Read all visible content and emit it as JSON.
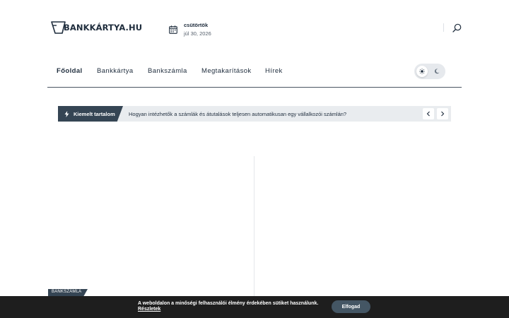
{
  "header": {
    "logo_text": "BANKKÁRTYA.HU",
    "date_day": "csütörtök",
    "date_value": "júl 30, 2026",
    "icons": {
      "calendar": "calendar-icon",
      "search": "search-icon"
    }
  },
  "nav": {
    "items": [
      {
        "label": "Főoldal",
        "active": true
      },
      {
        "label": "Bankkártya",
        "active": false
      },
      {
        "label": "Bankszámla",
        "active": false
      },
      {
        "label": "Megtakarítások",
        "active": false
      },
      {
        "label": "Hírek",
        "active": false
      }
    ],
    "theme_toggle": {
      "mode": "light",
      "icons": [
        "sun-icon",
        "moon-icon"
      ]
    }
  },
  "ticker": {
    "label": "Kiemelt tartalom",
    "headline": "Hogyan intézhetők a számlák és átutalások teljesen automatikusan egy vállalkozói számlán?",
    "icons": [
      "bolt-icon",
      "chevron-left-icon",
      "chevron-right-icon"
    ]
  },
  "content": {
    "category_tag": "BANKSZÁMLA"
  },
  "cookie": {
    "message": "A weboldalon a minőségi felhasználói élmény érdekében sütiket használunk.",
    "details_link": "Részletek",
    "accept_label": "Elfogad"
  },
  "colors": {
    "brand_dark": "#354554",
    "text": "#1f2d3d",
    "ticker_bg": "#e9ecef",
    "cookie_bg": "#1e1e1e",
    "accept_button": "#445664"
  }
}
